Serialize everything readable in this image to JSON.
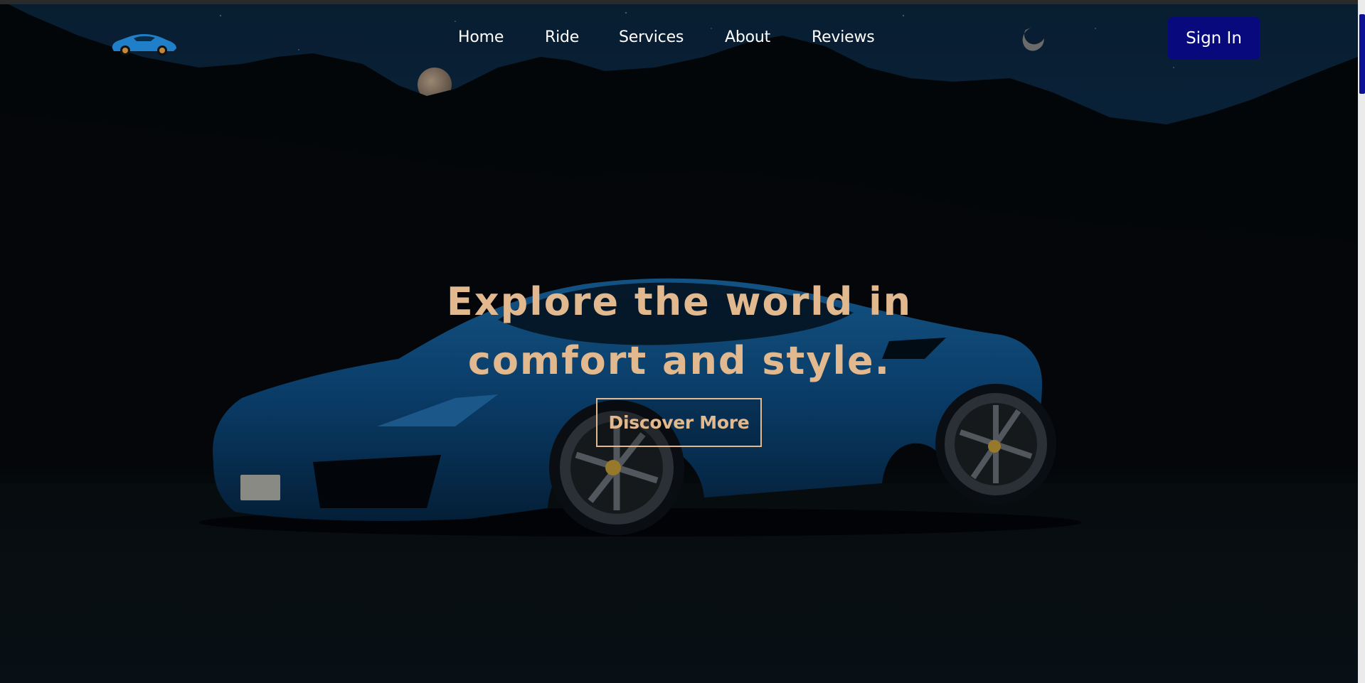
{
  "nav": {
    "items": [
      {
        "label": "Home"
      },
      {
        "label": "Ride"
      },
      {
        "label": "Services"
      },
      {
        "label": "About"
      },
      {
        "label": "Reviews"
      }
    ],
    "signin_label": "Sign In"
  },
  "icons": {
    "logo": "car-logo-icon",
    "theme_toggle": "moon-icon"
  },
  "hero": {
    "headline_line1": "Explore the world in",
    "headline_line2": "comfort and style.",
    "cta_label": "Discover More"
  },
  "colors": {
    "accent": "#e2b98e",
    "signin_bg": "#07097d",
    "nav_text": "#ffffff",
    "car_blue": "#0f5a98"
  }
}
